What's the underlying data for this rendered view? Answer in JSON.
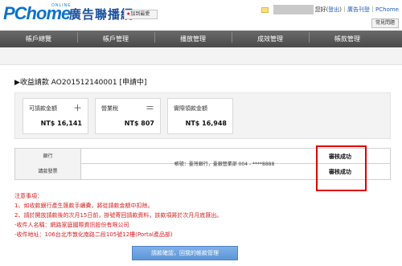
{
  "header": {
    "logo_brand": "PChome",
    "logo_online": "ONLINE",
    "logo_title": "廣告聯播網",
    "add_favorite": "加到最愛",
    "greeting_suffix": "您好",
    "logout": "登出",
    "ad_management": "廣告刊登",
    "pchome_link": "PChome",
    "faq_button": "常見問題"
  },
  "nav": {
    "items": [
      "帳戶總覽",
      "帳戶管理",
      "播放管理",
      "成效管理",
      "帳款管理"
    ]
  },
  "page": {
    "title": "▶收益請款 AO201512140001 [申請中]"
  },
  "summary": {
    "cards": [
      {
        "label": "可請款金額",
        "operator": "＋",
        "amount": "NT$ 16,141"
      },
      {
        "label": "營業稅",
        "operator": "＝",
        "amount": "NT$ 807"
      },
      {
        "label": "實際領款金額",
        "operator": "",
        "amount": "NT$ 16,948"
      }
    ]
  },
  "status_table": {
    "rows": [
      {
        "label": "銀行",
        "status": "審核成功"
      },
      {
        "label": "請款發票",
        "status": "審核成功"
      }
    ],
    "account_info": "帳號：臺灣銀行，臺銀營業部 004 - ****8888"
  },
  "notes": {
    "lines": [
      "注意事項：",
      "1、如收款銀行產生匯款手續費，將從請款金額中扣除。",
      "2、請於開放請款後的次月15日前，掛號寄回請款資料，該款項將於次月月底匯出。",
      "-收件人名稱：網路家庭國際資訊股份有限公司",
      "-收件地址：106台北市敦化南路二段105號12樓(Portal產品部)"
    ]
  },
  "actions": {
    "confirm_button": "請款確認，回我的帳款管理"
  },
  "colors": {
    "brand_blue": "#0a73c9",
    "nav_dark": "#555555",
    "alert_red": "#d61e1e",
    "button_blue": "#6aa3e0"
  }
}
